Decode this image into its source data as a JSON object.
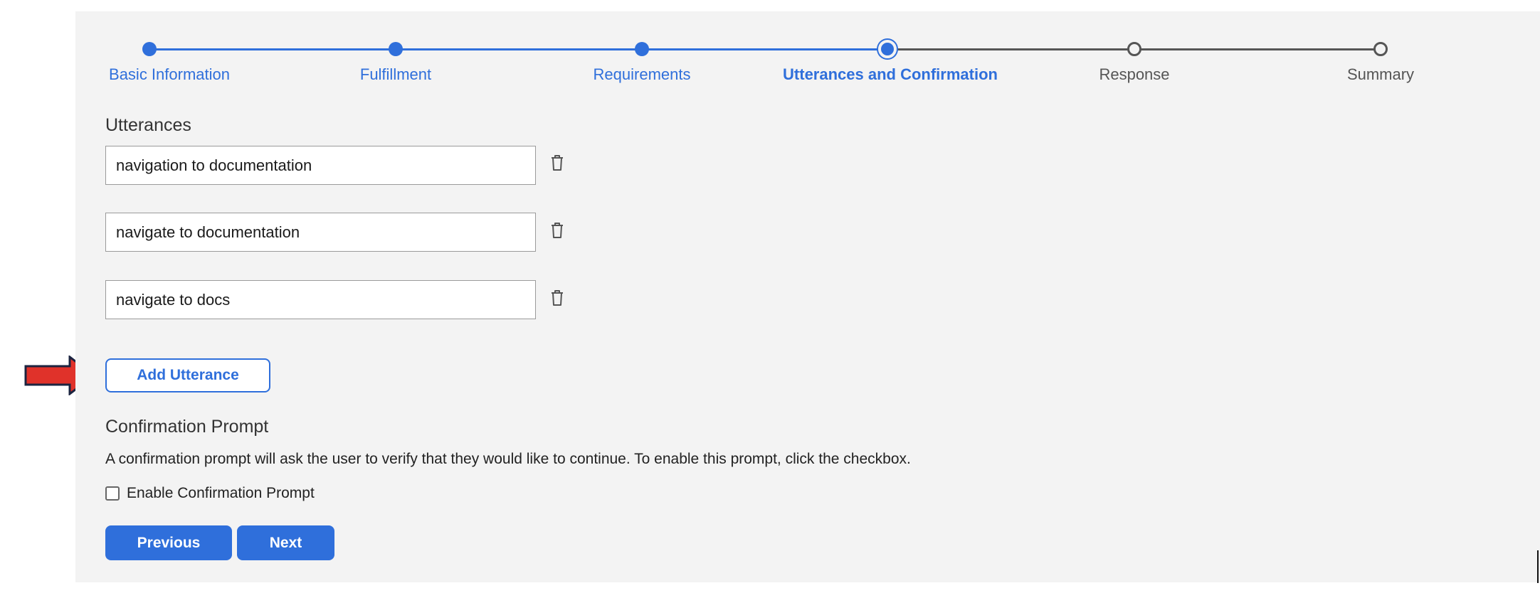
{
  "stepper": {
    "steps": [
      {
        "label": "Basic Information",
        "state": "done"
      },
      {
        "label": "Fulfillment",
        "state": "done"
      },
      {
        "label": "Requirements",
        "state": "done"
      },
      {
        "label": "Utterances and Confirmation",
        "state": "current"
      },
      {
        "label": "Response",
        "state": "todo"
      },
      {
        "label": "Summary",
        "state": "todo"
      }
    ]
  },
  "utterances": {
    "title": "Utterances",
    "items": [
      {
        "value": "navigation to documentation"
      },
      {
        "value": "navigate to documentation"
      },
      {
        "value": "navigate to docs"
      }
    ],
    "delete_icon": "trash-icon",
    "add_label": "Add Utterance"
  },
  "confirmation": {
    "title": "Confirmation Prompt",
    "description": "A confirmation prompt will ask the user to verify that they would like to continue. To enable this prompt, click the checkbox.",
    "checkbox_label": "Enable Confirmation Prompt",
    "checked": false
  },
  "nav": {
    "previous_label": "Previous",
    "next_label": "Next"
  },
  "colors": {
    "accent": "#2f6fdb",
    "panel_bg": "#f3f3f3",
    "annotation_arrow": "#e0322a"
  }
}
